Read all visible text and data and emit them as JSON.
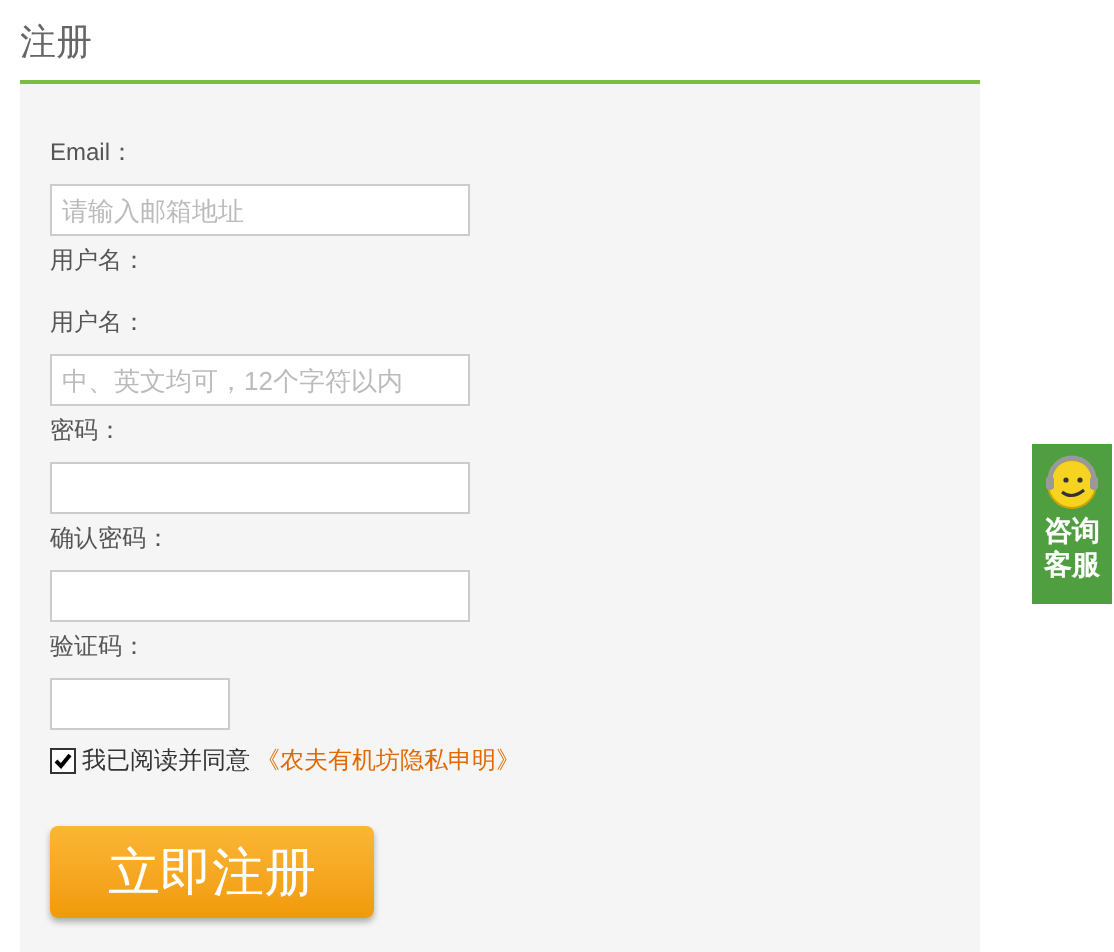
{
  "title": "注册",
  "form": [
    {
      "kind": "label",
      "text": "Email："
    },
    {
      "kind": "input",
      "placeholder": "请输入邮箱地址"
    },
    {
      "kind": "label",
      "text": "用户名："
    },
    {
      "kind": "label",
      "text": "用户名："
    },
    {
      "kind": "input",
      "placeholder": "中、英文均可，12个字符以内"
    },
    {
      "kind": "label",
      "text": "密码："
    },
    {
      "kind": "input"
    },
    {
      "kind": "label",
      "text": "确认密码："
    },
    {
      "kind": "input"
    },
    {
      "kind": "label",
      "text": "验证码："
    },
    {
      "kind": "short_input"
    }
  ],
  "agreement": {
    "checked": true,
    "text": "我已阅读并同意",
    "link": "《农夫有机坊隐私申明》"
  },
  "submit": "立即注册",
  "service_widget": {
    "lines": [
      "咨询",
      "客服"
    ]
  }
}
